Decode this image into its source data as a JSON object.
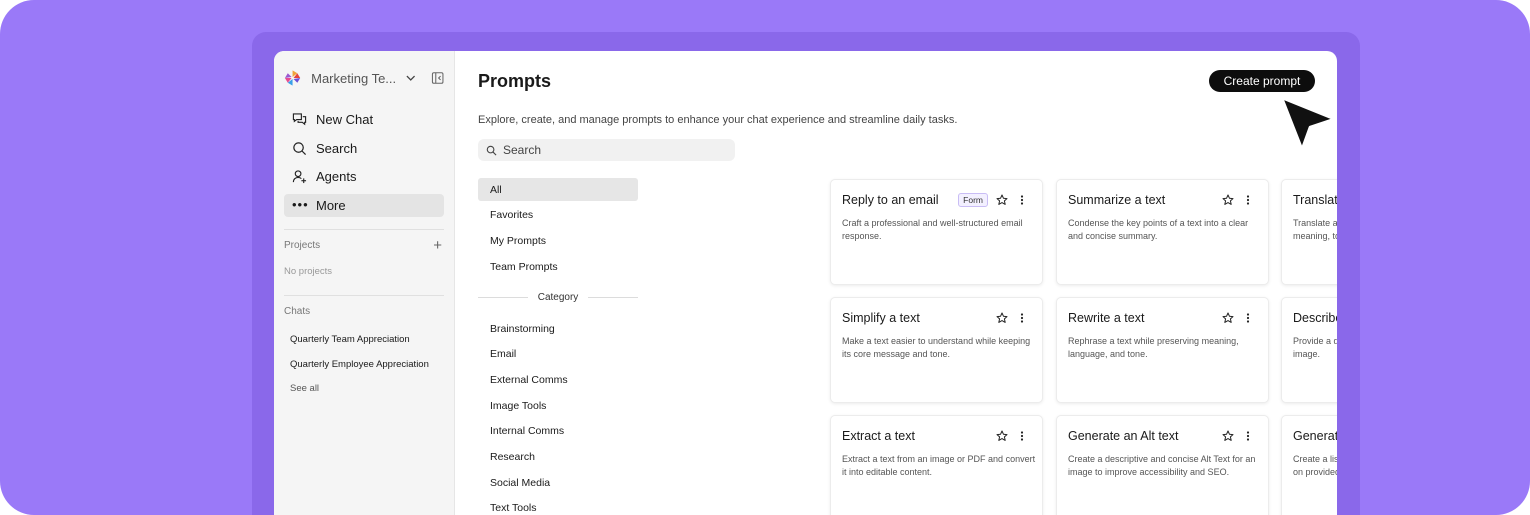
{
  "colors": {
    "background": "#9a79f8",
    "accent_dark": "#0d0d0d",
    "badge_border": "#c9bdf5"
  },
  "sidebar": {
    "workspace_name": "Marketing Te...",
    "workspace_icon": "workspace-logo-icon",
    "nav": [
      {
        "label": "New Chat",
        "icon": "chat-bubbles-icon"
      },
      {
        "label": "Search",
        "icon": "search-icon"
      },
      {
        "label": "Agents",
        "icon": "agent-user-icon"
      },
      {
        "label": "More",
        "icon": "more-dots-icon"
      }
    ],
    "projects_heading": "Projects",
    "projects_empty": "No projects",
    "chats_heading": "Chats",
    "chats": [
      "Quarterly Team Appreciation",
      "Quarterly Employee Appreciation"
    ],
    "see_all": "See all"
  },
  "main": {
    "title": "Prompts",
    "create_button": "Create prompt",
    "subtitle": "Explore, create, and manage prompts to enhance your chat experience and streamline daily tasks.",
    "search_placeholder": "Search",
    "filters": [
      "All",
      "Favorites",
      "My Prompts",
      "Team Prompts"
    ],
    "category_heading": "Category",
    "categories": [
      "Brainstorming",
      "Email",
      "External Comms",
      "Image Tools",
      "Internal Comms",
      "Research",
      "Social Media",
      "Text Tools"
    ],
    "cards": [
      {
        "title": "Reply to an email",
        "badge": "Form",
        "desc": "Craft a professional and well-structured email response."
      },
      {
        "title": "Summarize a text",
        "badge": "",
        "desc": "Condense the key points of a text into a clear and concise summary."
      },
      {
        "title": "Translate a text",
        "badge": "",
        "desc": "Translate a text accurately while maintaining meaning, tone, and cultural nuances."
      },
      {
        "title": "Simplify a text",
        "badge": "",
        "desc": "Make a text easier to understand while keeping its core message and tone."
      },
      {
        "title": "Rewrite a text",
        "badge": "",
        "desc": "Rephrase a text while preserving meaning, language, and tone."
      },
      {
        "title": "Describe an image",
        "badge": "",
        "desc": "Provide a detailed and relevant description of an image."
      },
      {
        "title": "Extract a text",
        "badge": "",
        "desc": "Extract a text from an image or PDF and convert it into editable content."
      },
      {
        "title": "Generate an Alt text",
        "badge": "",
        "desc": "Create a descriptive and concise Alt Text for an image to improve accessibility and SEO."
      },
      {
        "title": "Generate FAQs",
        "badge": "",
        "desc": "Create a list of frequently asked questions based on provided information or knowledge."
      }
    ]
  }
}
